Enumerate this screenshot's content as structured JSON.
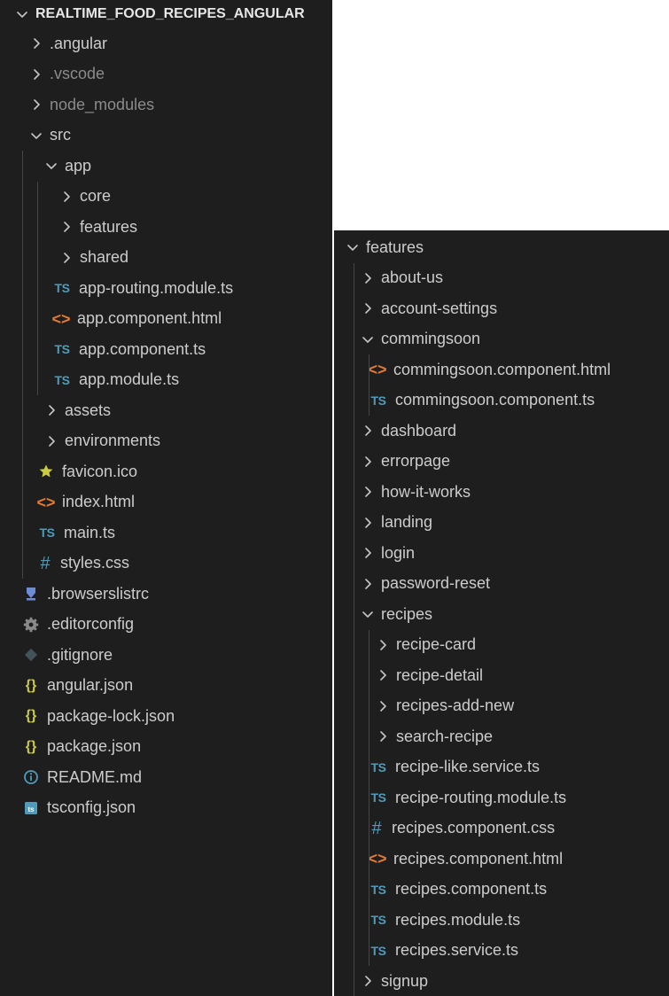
{
  "left_panel": {
    "root": ".",
    "root_label": "REALTIME_FOOD_RECIPES_ANGULAR",
    "items": [
      {
        "label": ".angular",
        "depth": 0,
        "kind": "folder",
        "expanded": false
      },
      {
        "label": ".vscode",
        "depth": 0,
        "kind": "folder",
        "expanded": false,
        "dim": true
      },
      {
        "label": "node_modules",
        "depth": 0,
        "kind": "folder",
        "expanded": false,
        "dim": true
      },
      {
        "label": "src",
        "depth": 0,
        "kind": "folder",
        "expanded": true
      },
      {
        "label": "app",
        "depth": 1,
        "kind": "folder",
        "expanded": true
      },
      {
        "label": "core",
        "depth": 2,
        "kind": "folder",
        "expanded": false
      },
      {
        "label": "features",
        "depth": 2,
        "kind": "folder",
        "expanded": false
      },
      {
        "label": "shared",
        "depth": 2,
        "kind": "folder",
        "expanded": false
      },
      {
        "label": "app-routing.module.ts",
        "depth": 2,
        "kind": "ts"
      },
      {
        "label": "app.component.html",
        "depth": 2,
        "kind": "html"
      },
      {
        "label": "app.component.ts",
        "depth": 2,
        "kind": "ts"
      },
      {
        "label": "app.module.ts",
        "depth": 2,
        "kind": "ts"
      },
      {
        "label": "assets",
        "depth": 1,
        "kind": "folder",
        "expanded": false
      },
      {
        "label": "environments",
        "depth": 1,
        "kind": "folder",
        "expanded": false
      },
      {
        "label": "favicon.ico",
        "depth": 1,
        "kind": "star"
      },
      {
        "label": "index.html",
        "depth": 1,
        "kind": "html"
      },
      {
        "label": "main.ts",
        "depth": 1,
        "kind": "ts"
      },
      {
        "label": "styles.css",
        "depth": 1,
        "kind": "css"
      },
      {
        "label": ".browserslistrc",
        "depth": 0,
        "kind": "browsers"
      },
      {
        "label": ".editorconfig",
        "depth": 0,
        "kind": "gear"
      },
      {
        "label": ".gitignore",
        "depth": 0,
        "kind": "git"
      },
      {
        "label": "angular.json",
        "depth": 0,
        "kind": "json"
      },
      {
        "label": "package-lock.json",
        "depth": 0,
        "kind": "json"
      },
      {
        "label": "package.json",
        "depth": 0,
        "kind": "json"
      },
      {
        "label": "README.md",
        "depth": 0,
        "kind": "info"
      },
      {
        "label": "tsconfig.json",
        "depth": 0,
        "kind": "tsconf"
      }
    ]
  },
  "right_panel": {
    "items": [
      {
        "label": "features",
        "depth": 0,
        "kind": "folder",
        "expanded": true
      },
      {
        "label": "about-us",
        "depth": 1,
        "kind": "folder",
        "expanded": false
      },
      {
        "label": "account-settings",
        "depth": 1,
        "kind": "folder",
        "expanded": false
      },
      {
        "label": "commingsoon",
        "depth": 1,
        "kind": "folder",
        "expanded": true
      },
      {
        "label": "commingsoon.component.html",
        "depth": 2,
        "kind": "html"
      },
      {
        "label": "commingsoon.component.ts",
        "depth": 2,
        "kind": "ts"
      },
      {
        "label": "dashboard",
        "depth": 1,
        "kind": "folder",
        "expanded": false
      },
      {
        "label": "errorpage",
        "depth": 1,
        "kind": "folder",
        "expanded": false
      },
      {
        "label": "how-it-works",
        "depth": 1,
        "kind": "folder",
        "expanded": false
      },
      {
        "label": "landing",
        "depth": 1,
        "kind": "folder",
        "expanded": false
      },
      {
        "label": "login",
        "depth": 1,
        "kind": "folder",
        "expanded": false
      },
      {
        "label": "password-reset",
        "depth": 1,
        "kind": "folder",
        "expanded": false
      },
      {
        "label": "recipes",
        "depth": 1,
        "kind": "folder",
        "expanded": true
      },
      {
        "label": "recipe-card",
        "depth": 2,
        "kind": "folder",
        "expanded": false
      },
      {
        "label": "recipe-detail",
        "depth": 2,
        "kind": "folder",
        "expanded": false
      },
      {
        "label": "recipes-add-new",
        "depth": 2,
        "kind": "folder",
        "expanded": false
      },
      {
        "label": "search-recipe",
        "depth": 2,
        "kind": "folder",
        "expanded": false
      },
      {
        "label": "recipe-like.service.ts",
        "depth": 2,
        "kind": "ts"
      },
      {
        "label": "recipe-routing.module.ts",
        "depth": 2,
        "kind": "ts"
      },
      {
        "label": "recipes.component.css",
        "depth": 2,
        "kind": "css"
      },
      {
        "label": "recipes.component.html",
        "depth": 2,
        "kind": "html"
      },
      {
        "label": "recipes.component.ts",
        "depth": 2,
        "kind": "ts"
      },
      {
        "label": "recipes.module.ts",
        "depth": 2,
        "kind": "ts"
      },
      {
        "label": "recipes.service.ts",
        "depth": 2,
        "kind": "ts"
      },
      {
        "label": "signup",
        "depth": 1,
        "kind": "folder",
        "expanded": false
      }
    ]
  },
  "icons": {
    "folder-collapsed": "chevron-right-icon",
    "folder-expanded": "chevron-down-icon",
    "ts": "typescript-file-icon",
    "html": "html-file-icon",
    "css": "css-file-icon",
    "json": "json-file-icon",
    "star": "favicon-star-icon",
    "gear": "editorconfig-gear-icon",
    "git": "gitignore-icon",
    "browsers": "browserslist-icon",
    "info": "readme-info-icon",
    "tsconf": "tsconfig-icon"
  },
  "glyphs": {
    "ts": "TS",
    "html": "<>",
    "css": "#",
    "json": "{}"
  },
  "colors": {
    "background": "#1e1e1e",
    "text": "#cccccc",
    "dim_text": "#8b8b8b",
    "ts": "#519aba",
    "html": "#e37933",
    "json": "#cbcb41",
    "star": "#cbcb41",
    "indent_guide": "#454545"
  }
}
